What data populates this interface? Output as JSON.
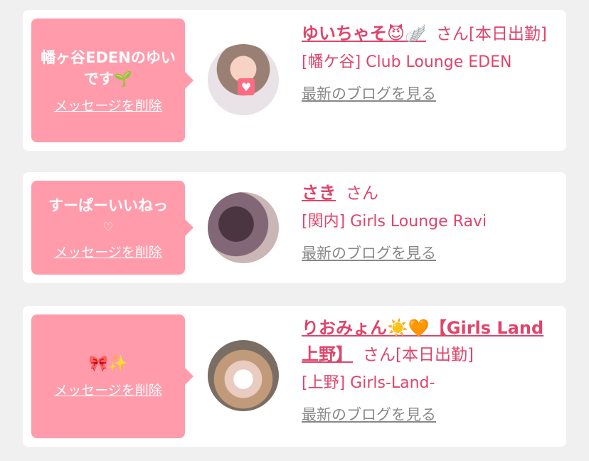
{
  "entries": [
    {
      "message": "幡ヶ谷EDENのゆいです🌱",
      "delete_label": "メッセージを削除",
      "name": "ゆいちゃそ😈🪽",
      "san": "さん",
      "status": "[本日出勤]",
      "shop": "[幡ケ谷] Club Lounge EDEN",
      "blog_label": "最新のブログを見る"
    },
    {
      "message": "すーぱーいいねっ",
      "heart": "♡",
      "delete_label": "メッセージを削除",
      "name": "さき",
      "san": "さん",
      "shop": "[関内] Girls Lounge Ravi",
      "blog_label": "最新のブログを見る"
    },
    {
      "message": "🎀✨",
      "delete_label": "メッセージを削除",
      "name": "りおみょん☀️🧡【Girls Land上野】",
      "san": "さん",
      "status": "[本日出勤]",
      "shop": "[上野] Girls-Land-",
      "blog_label": "最新のブログを見る"
    }
  ],
  "colors": {
    "bubble": "#ff9bab",
    "accent": "#e0446b",
    "muted": "#888888",
    "background": "#f0f0f0"
  }
}
